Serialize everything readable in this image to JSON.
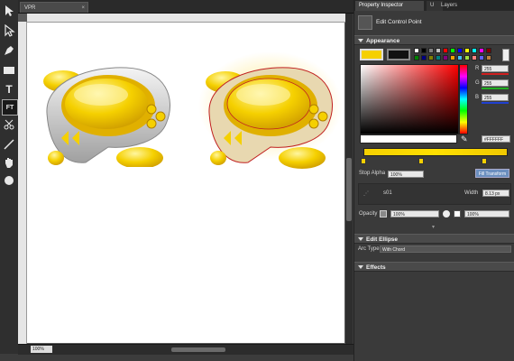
{
  "document": {
    "tab_title": "VPR",
    "close_glyph": "×",
    "zoom_value": "100%"
  },
  "toolbar": {
    "tools": [
      {
        "name": "pointer-tool-icon"
      },
      {
        "name": "subselect-tool-icon"
      },
      {
        "name": "pen-tool-icon"
      },
      {
        "name": "pen-add-tool-icon"
      },
      {
        "name": "rectangle-tool-icon"
      },
      {
        "name": "text-tool-icon",
        "glyph": "T"
      },
      {
        "name": "free-transform-tool-icon",
        "glyph": "FT"
      },
      {
        "name": "knife-tool-icon"
      },
      {
        "name": "line-tool-icon"
      },
      {
        "name": "hand-tool-icon"
      },
      {
        "name": "zoom-tool-icon"
      }
    ]
  },
  "panel": {
    "tabs": [
      "Property Inspector",
      "U",
      "Layers"
    ],
    "header_title": "Edit Control Point",
    "appearance": {
      "title": "Appearance",
      "r_label": "R",
      "r_value": "255",
      "g_label": "G",
      "g_value": "255",
      "b_label": "B",
      "b_value": "255",
      "hex_value": "#FFFFFF",
      "stop_alpha_label": "Stop Alpha",
      "stop_alpha_value": "100%",
      "transform_button": "Fill Transform",
      "stroke_name": "s01",
      "width_label": "Width",
      "width_value": "8.13 px",
      "opacity_label": "Opacity",
      "opacity_value": "100%",
      "opacity_value_2": "100%",
      "palette_colors": [
        "#ffffff",
        "#000000",
        "#808080",
        "#c0c0c0",
        "#ff0000",
        "#00ff00",
        "#0000ff",
        "#ffff00",
        "#00ffff",
        "#ff00ff",
        "#800000",
        "#008000",
        "#000080",
        "#808000",
        "#008080",
        "#800080",
        "#f0a000",
        "#40c0ff",
        "#a0e040",
        "#ff8080",
        "#6060ff",
        "#c08040"
      ]
    },
    "edit_ellipse": {
      "title": "Edit Ellipse",
      "arc_type_label": "Arc Type",
      "arc_type_value": "With Chord"
    },
    "effects": {
      "title": "Effects"
    }
  },
  "colors": {
    "accent_yellow": "#f5d000",
    "panel_bg": "#3a3a3a",
    "canvas_bg": "#ffffff"
  }
}
